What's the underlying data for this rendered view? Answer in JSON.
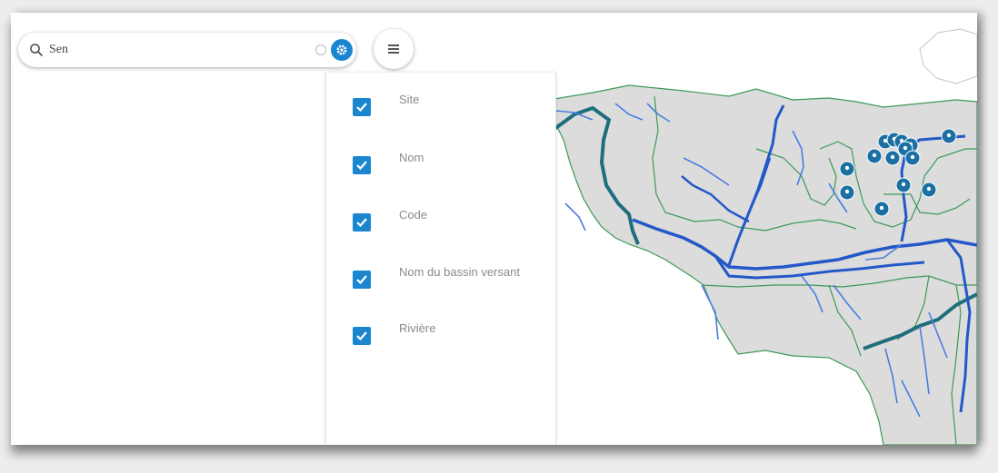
{
  "search": {
    "value": "Sen",
    "placeholder": ""
  },
  "toolbar": {
    "settings_icon": "gear-icon",
    "menu_icon": "hamburger-menu-icon",
    "clear_icon": "clear-icon"
  },
  "columns": [
    {
      "label": "Site",
      "checked": true
    },
    {
      "label": "Nom",
      "checked": true
    },
    {
      "label": "Code",
      "checked": true
    },
    {
      "label": "Nom du bassin versant",
      "checked": true
    },
    {
      "label": "Rivière",
      "checked": true
    }
  ],
  "colors": {
    "accent": "#1a86d0",
    "river": "#2358c8",
    "main_river": "#1f6e7e",
    "basin_border": "#3c9a57",
    "land": "#dcdcdc",
    "marker": "#1a6fa3"
  },
  "map": {
    "marker_count": 14
  }
}
